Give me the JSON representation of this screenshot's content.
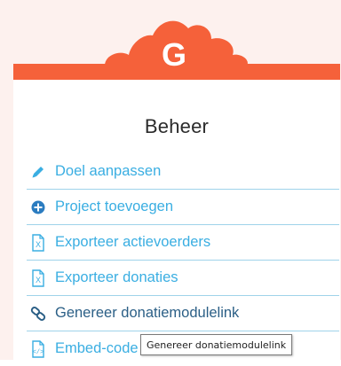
{
  "logo": {
    "letter": "G"
  },
  "panel": {
    "title": "Beheer"
  },
  "menu": {
    "items": [
      {
        "label": "Doel aanpassen",
        "icon": "pencil-icon"
      },
      {
        "label": "Project toevoegen",
        "icon": "plus-circle-icon"
      },
      {
        "label": "Exporteer actievoerders",
        "icon": "excel-file-icon"
      },
      {
        "label": "Exporteer donaties",
        "icon": "excel-file-icon"
      },
      {
        "label": "Genereer donatiemodulelink",
        "icon": "link-icon"
      },
      {
        "label": "Embed-code",
        "icon": "code-file-icon"
      }
    ]
  },
  "tooltip": {
    "text": "Genereer donatiemodulelink"
  },
  "colors": {
    "brand": "#f5613a",
    "link": "#3aaee2",
    "divider": "#9fd3ea",
    "link_active": "#2b5f86"
  }
}
